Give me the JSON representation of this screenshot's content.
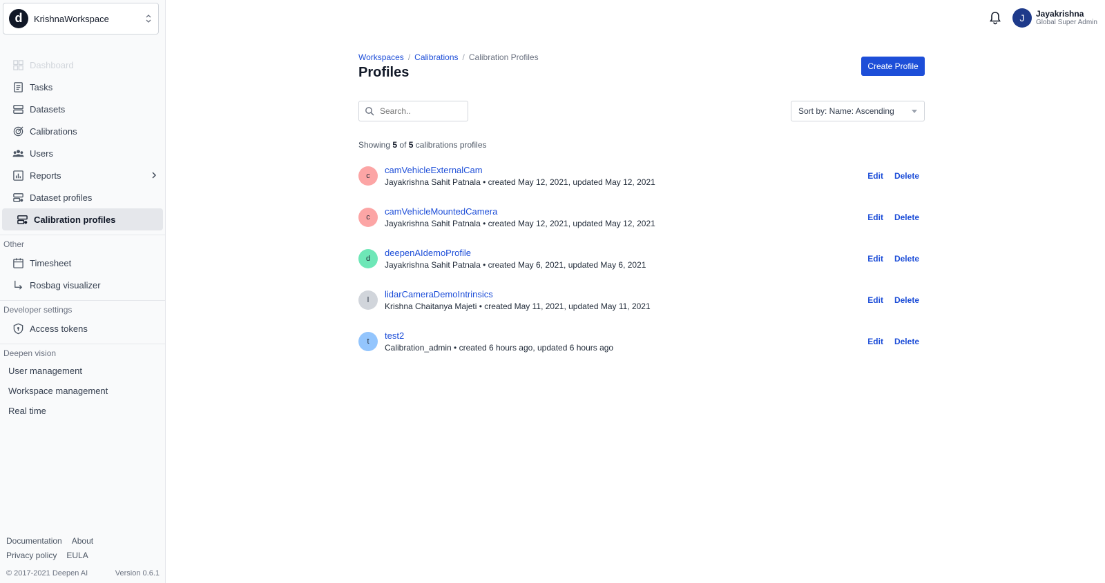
{
  "workspace": {
    "logo_letter": "d",
    "name": "KrishnaWorkspace"
  },
  "nav": {
    "main": [
      {
        "label": "Dashboard",
        "icon": "dashboard-icon",
        "disabled": true
      },
      {
        "label": "Tasks",
        "icon": "tasks-icon"
      },
      {
        "label": "Datasets",
        "icon": "datasets-icon"
      },
      {
        "label": "Calibrations",
        "icon": "calibrations-icon"
      },
      {
        "label": "Users",
        "icon": "users-icon"
      },
      {
        "label": "Reports",
        "icon": "reports-icon",
        "has_children": true
      },
      {
        "label": "Dataset profiles",
        "icon": "dataset-profiles-icon"
      },
      {
        "label": "Calibration profiles",
        "icon": "calibration-profiles-icon",
        "active": true
      }
    ],
    "other_title": "Other",
    "other": [
      {
        "label": "Timesheet",
        "icon": "calendar-icon"
      },
      {
        "label": "Rosbag visualizer",
        "icon": "arrow-down-right-icon"
      }
    ],
    "developer_title": "Developer settings",
    "developer": [
      {
        "label": "Access tokens",
        "icon": "shield-icon"
      }
    ],
    "vision_title": "Deepen vision",
    "vision": [
      {
        "label": "User management"
      },
      {
        "label": "Workspace management"
      },
      {
        "label": "Real time"
      }
    ]
  },
  "footer": {
    "documentation": "Documentation",
    "about": "About",
    "privacy": "Privacy policy",
    "eula": "EULA",
    "copyright": "© 2017-2021 Deepen AI",
    "version": "Version 0.6.1"
  },
  "user": {
    "initial": "J",
    "name": "Jayakrishna",
    "role": "Global Super Admin"
  },
  "breadcrumb": {
    "workspaces": "Workspaces",
    "calibrations": "Calibrations",
    "current": "Calibration Profiles",
    "sep": "/"
  },
  "page": {
    "title": "Profiles",
    "create_button": "Create Profile",
    "search_placeholder": "Search..",
    "sort_label": "Sort by: Name: Ascending",
    "showing_prefix": "Showing",
    "showing_count": "5",
    "showing_of": "of",
    "showing_total": "5",
    "showing_suffix": "calibrations profiles"
  },
  "actions": {
    "edit": "Edit",
    "delete": "Delete"
  },
  "profiles": [
    {
      "initial": "c",
      "color": "#fca5a5",
      "name": "camVehicleExternalCam",
      "meta": "Jayakrishna Sahit Patnala • created May 12, 2021, updated May 12, 2021"
    },
    {
      "initial": "c",
      "color": "#fca5a5",
      "name": "camVehicleMountedCamera",
      "meta": "Jayakrishna Sahit Patnala • created May 12, 2021, updated May 12, 2021"
    },
    {
      "initial": "d",
      "color": "#6ee7b7",
      "name": "deepenAIdemoProfile",
      "meta": "Jayakrishna Sahit Patnala • created May 6, 2021, updated May 6, 2021"
    },
    {
      "initial": "l",
      "color": "#d1d5db",
      "name": "lidarCameraDemoIntrinsics",
      "meta": "Krishna Chaitanya Majeti • created May 11, 2021, updated May 11, 2021"
    },
    {
      "initial": "t",
      "color": "#93c5fd",
      "name": "test2",
      "meta": "Calibration_admin • created 6 hours ago, updated 6 hours ago"
    }
  ],
  "colors": {
    "accent": "#1d4ed8",
    "sidebar_bg": "#f9fafb",
    "active_item_bg": "#e5e7eb"
  }
}
